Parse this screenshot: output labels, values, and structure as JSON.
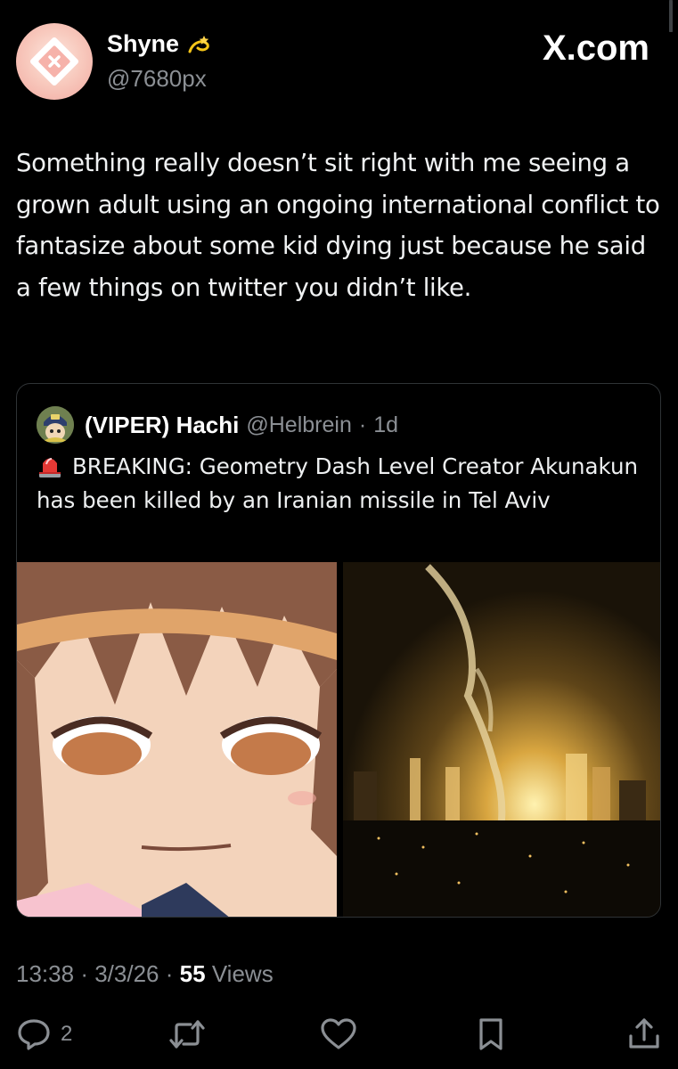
{
  "author": {
    "display_name": "Shyne",
    "handle": "@7680px",
    "badge_icon": "dizzy-emoji"
  },
  "brand": "X.com",
  "tweet": {
    "text": "Something really doesn’t sit right with me seeing a grown adult using an ongoing international conflict to fantasize about some kid dying just because he said a few things on twitter you didn’t like."
  },
  "quoted_tweet": {
    "display_name": "(VIPER) Hachi",
    "handle": "@Helbrein",
    "separator": "·",
    "time": "1d",
    "lead_icon": "police-siren-emoji",
    "text": "BREAKING: Geometry Dash Level Creator Akunakun has been killed by an Iranian missile in Tel Aviv"
  },
  "meta": {
    "time": "13:38",
    "date": "3/3/26",
    "separator": "·",
    "views_count": "55",
    "views_label": "Views"
  },
  "actions": {
    "reply_count": "2"
  },
  "colors": {
    "background": "#000000",
    "text": "#e7e9ea",
    "secondary": "#8b8f94",
    "border": "#2f3336"
  }
}
